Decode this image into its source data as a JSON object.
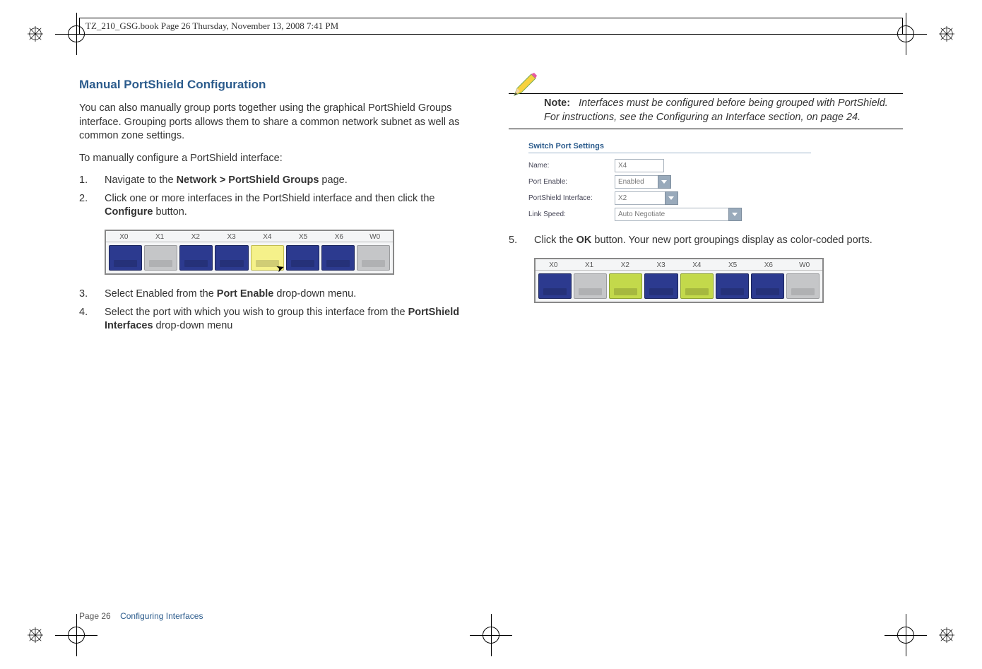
{
  "doc_header": "TZ_210_GSG.book  Page 26  Thursday, November 13, 2008  7:41 PM",
  "left": {
    "heading": "Manual PortShield Configuration",
    "intro": "You can also manually group ports together using the graphical PortShield Groups interface. Grouping ports allows them to share a common network subnet as well as common zone settings.",
    "preamble": "To manually configure a PortShield interface:",
    "step1_pre": "Navigate to the ",
    "step1_bold": "Network > PortShield Groups",
    "step1_post": " page.",
    "step2_pre": "Click one or more interfaces in the PortShield interface and then click the ",
    "step2_bold": "Configure",
    "step2_post": " button.",
    "step3_pre": "Select Enabled from the ",
    "step3_bold": "Port Enable",
    "step3_post": " drop-down menu.",
    "step4_pre": "Select the port with which you wish to group this interface from the ",
    "step4_bold": "PortShield Interfaces",
    "step4_post": " drop-down menu"
  },
  "right": {
    "note_label": "Note:",
    "note_body": "Interfaces must be configured before being grouped with PortShield. For instructions, see the Configuring an Interface section, on page 24.",
    "switch": {
      "title": "Switch Port Settings",
      "name_label": "Name:",
      "name_value": "X4",
      "enable_label": "Port Enable:",
      "enable_value": "Enabled",
      "psif_label": "PortShield Interface:",
      "psif_value": "X2",
      "link_label": "Link Speed:",
      "link_value": "Auto Negotiate"
    },
    "step5_pre": "Click the ",
    "step5_bold": "OK",
    "step5_post": " button. Your new port groupings display as color-coded ports."
  },
  "port_labels": [
    "X0",
    "X1",
    "X2",
    "X3",
    "X4",
    "X5",
    "X6",
    "W0"
  ],
  "footer": {
    "page": "Page 26",
    "section": "Configuring Interfaces"
  }
}
